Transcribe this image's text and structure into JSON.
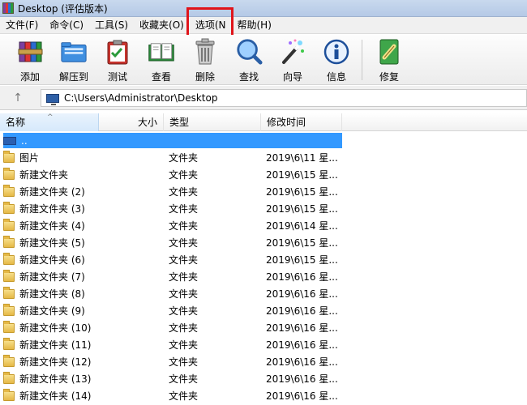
{
  "window": {
    "title": "Desktop (评估版本)"
  },
  "menu": [
    "文件(F)",
    "命令(C)",
    "工具(S)",
    "收藏夹(O)",
    "选项(N",
    "帮助(H)"
  ],
  "toolbar": [
    {
      "label": "添加",
      "icon": "archive-add-icon"
    },
    {
      "label": "解压到",
      "icon": "extract-folder-icon"
    },
    {
      "label": "测试",
      "icon": "test-clipboard-icon"
    },
    {
      "label": "查看",
      "icon": "view-book-icon"
    },
    {
      "label": "删除",
      "icon": "trash-icon"
    },
    {
      "label": "查找",
      "icon": "magnifier-icon"
    },
    {
      "label": "向导",
      "icon": "wizard-wand-icon"
    },
    {
      "label": "信息",
      "icon": "info-icon"
    },
    {
      "label": "修复",
      "icon": "repair-kit-icon"
    }
  ],
  "address": {
    "path": "C:\\Users\\Administrator\\Desktop",
    "up_symbol": "↑"
  },
  "columns": {
    "name": "名称",
    "size": "大小",
    "type": "类型",
    "modified": "修改时间",
    "sort_symbol": "^"
  },
  "rows": [
    {
      "name": "..",
      "type": "",
      "modified": "",
      "kind": "up"
    },
    {
      "name": "图片",
      "type": "文件夹",
      "modified": "2019\\6\\11 星...",
      "kind": "folder"
    },
    {
      "name": "新建文件夹",
      "type": "文件夹",
      "modified": "2019\\6\\15 星...",
      "kind": "folder"
    },
    {
      "name": "新建文件夹 (2)",
      "type": "文件夹",
      "modified": "2019\\6\\15 星...",
      "kind": "folder"
    },
    {
      "name": "新建文件夹 (3)",
      "type": "文件夹",
      "modified": "2019\\6\\15 星...",
      "kind": "folder"
    },
    {
      "name": "新建文件夹 (4)",
      "type": "文件夹",
      "modified": "2019\\6\\14 星...",
      "kind": "folder"
    },
    {
      "name": "新建文件夹 (5)",
      "type": "文件夹",
      "modified": "2019\\6\\15 星...",
      "kind": "folder"
    },
    {
      "name": "新建文件夹 (6)",
      "type": "文件夹",
      "modified": "2019\\6\\15 星...",
      "kind": "folder"
    },
    {
      "name": "新建文件夹 (7)",
      "type": "文件夹",
      "modified": "2019\\6\\16 星...",
      "kind": "folder"
    },
    {
      "name": "新建文件夹 (8)",
      "type": "文件夹",
      "modified": "2019\\6\\16 星...",
      "kind": "folder"
    },
    {
      "name": "新建文件夹 (9)",
      "type": "文件夹",
      "modified": "2019\\6\\16 星...",
      "kind": "folder"
    },
    {
      "name": "新建文件夹 (10)",
      "type": "文件夹",
      "modified": "2019\\6\\16 星...",
      "kind": "folder"
    },
    {
      "name": "新建文件夹 (11)",
      "type": "文件夹",
      "modified": "2019\\6\\16 星...",
      "kind": "folder"
    },
    {
      "name": "新建文件夹 (12)",
      "type": "文件夹",
      "modified": "2019\\6\\16 星...",
      "kind": "folder"
    },
    {
      "name": "新建文件夹 (13)",
      "type": "文件夹",
      "modified": "2019\\6\\16 星...",
      "kind": "folder"
    },
    {
      "name": "新建文件夹 (14)",
      "type": "文件夹",
      "modified": "2019\\6\\16 星...",
      "kind": "folder"
    }
  ],
  "colors": {
    "selection": "#3399ff",
    "highlight_box": "#e0141a"
  }
}
